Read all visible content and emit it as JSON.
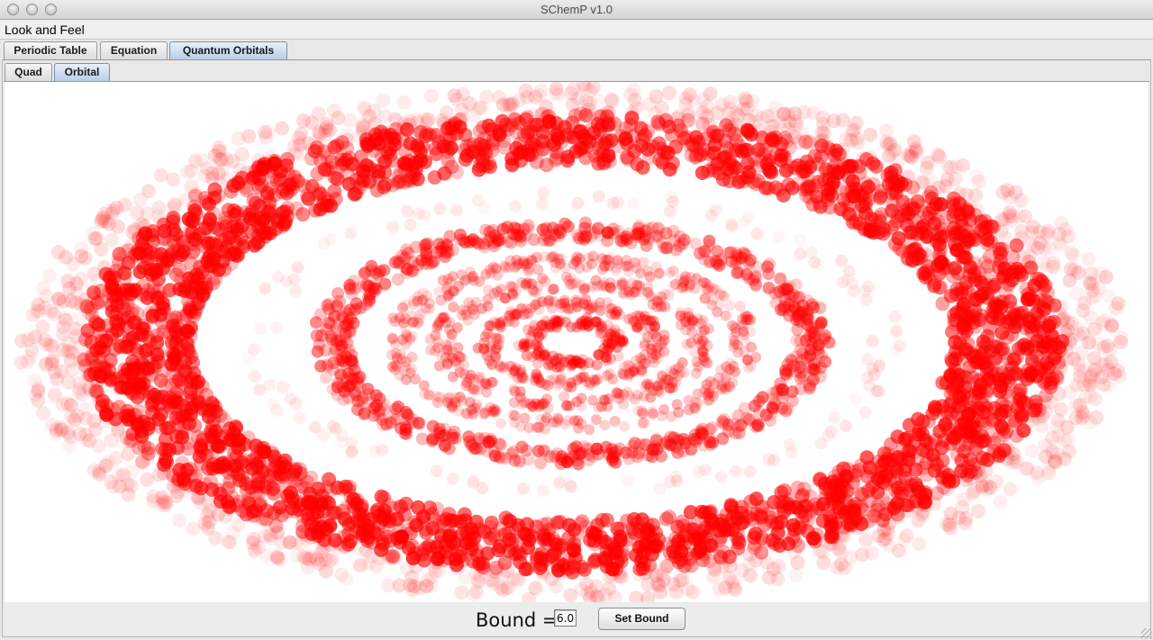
{
  "window": {
    "title": "SChemP v1.0"
  },
  "menubar": {
    "items": [
      "Look and Feel"
    ]
  },
  "tabs": {
    "main": [
      "Periodic Table",
      "Equation",
      "Quantum Orbitals"
    ],
    "main_selected": "Quantum Orbitals",
    "sub": [
      "Quad",
      "Orbital"
    ],
    "sub_selected": "Orbital"
  },
  "orbital": {
    "point_color": "#ff0000",
    "background": "#ffffff"
  },
  "controls": {
    "bound_label": "Bound =",
    "bound_value": "6.0",
    "set_bound_label": "Set Bound"
  }
}
